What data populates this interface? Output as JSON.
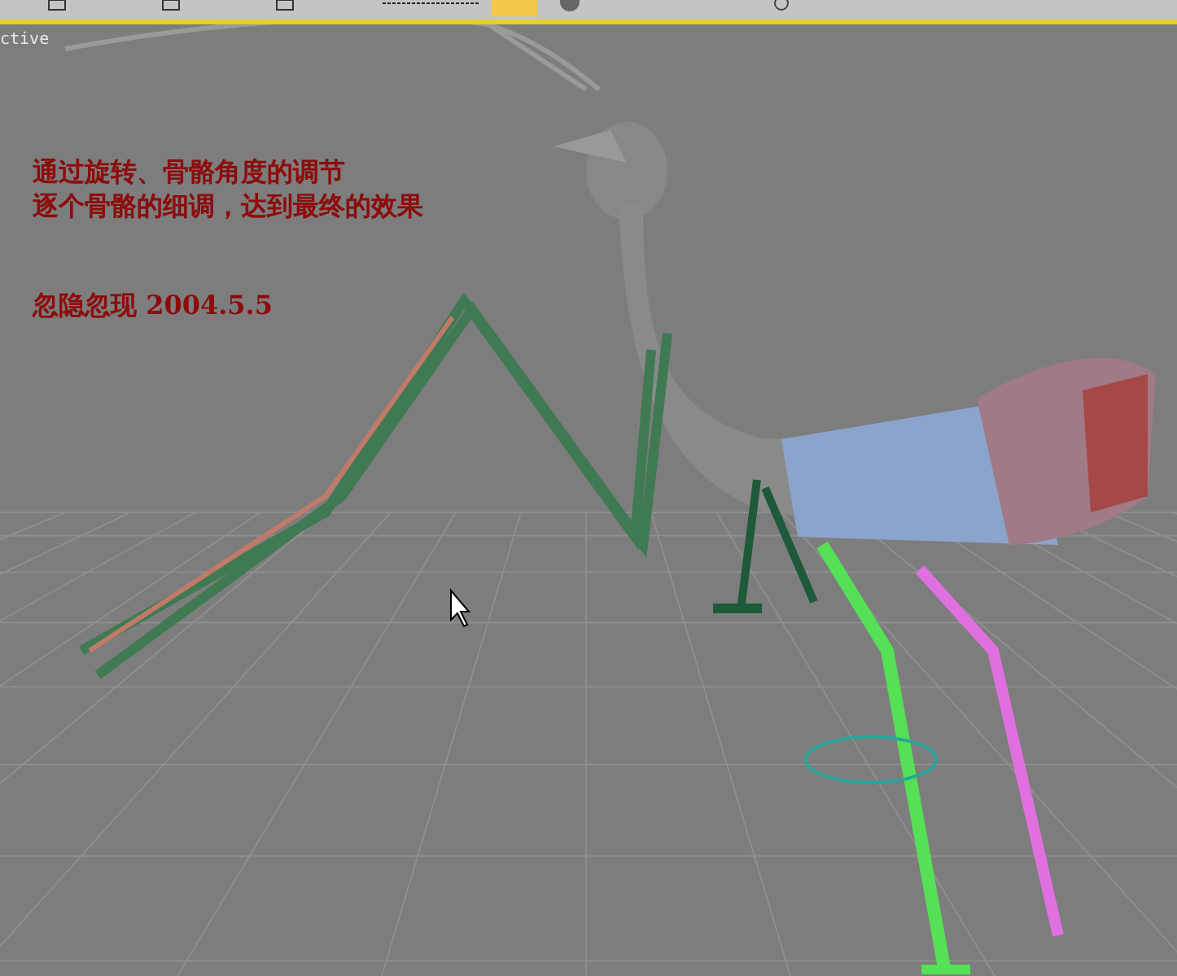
{
  "viewport": {
    "label": "ctive",
    "active": true
  },
  "annotation": {
    "lines": [
      "通过旋转、骨骼角度的调节",
      "逐个骨骼的细调，达到最终的效果"
    ],
    "note": "忽隐忽现 2004.5.5"
  }
}
